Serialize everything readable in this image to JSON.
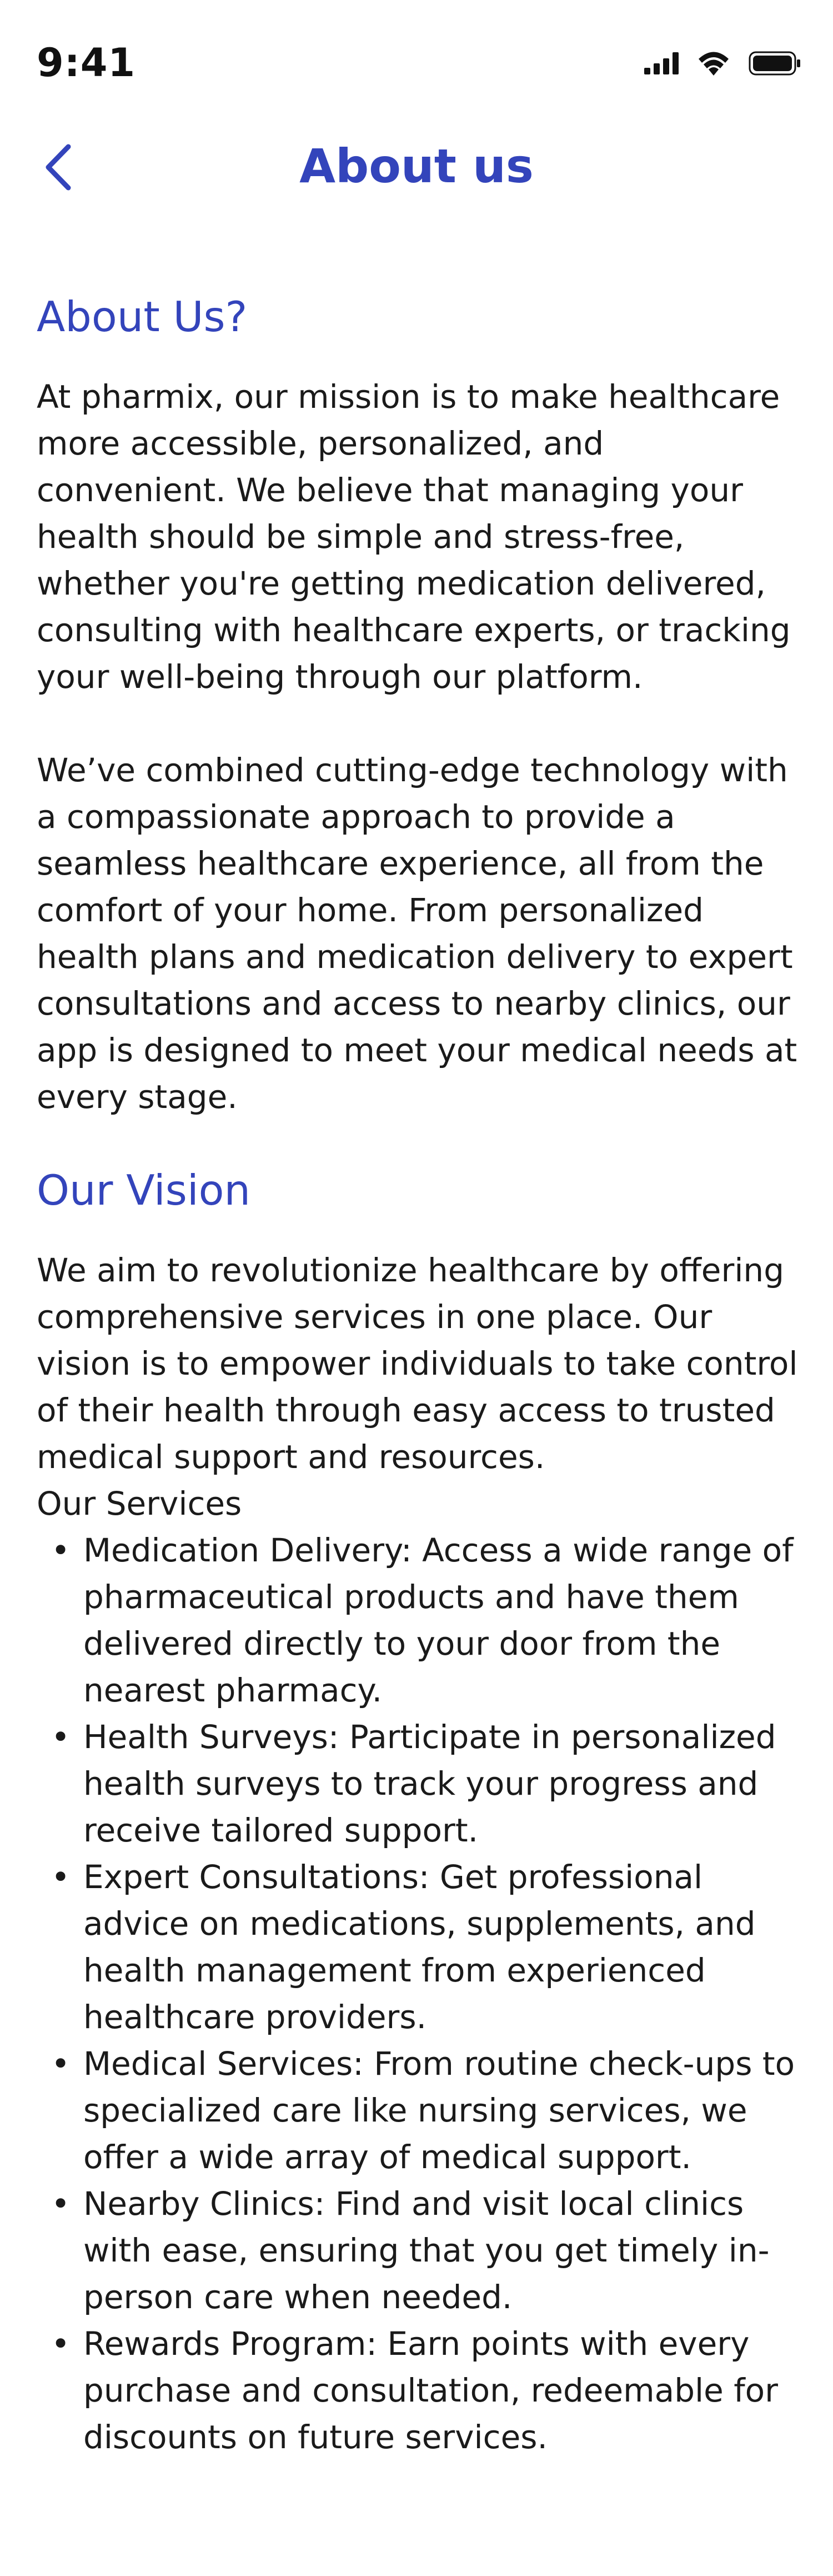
{
  "status_bar": {
    "time": "9:41",
    "icons": [
      "cellular-signal-icon",
      "wifi-icon",
      "battery-icon"
    ]
  },
  "nav": {
    "title": "About us",
    "back_icon": "chevron-left-icon"
  },
  "about": {
    "heading": "About Us?",
    "paragraphs": [
      "At pharmix, our mission is to make healthcare more accessible, personalized, and convenient. We believe that managing your health should be simple and stress-free, whether you're getting medication delivered, consulting with healthcare experts, or tracking your well-being through our platform.",
      "We’ve combined cutting-edge technology with a compassionate approach to provide a seamless healthcare experience, all from the comfort of your home. From personalized health plans and medication delivery to expert consultations and access to nearby clinics, our app is designed to meet your medical needs at every stage."
    ]
  },
  "vision": {
    "heading": "Our Vision",
    "paragraph": "We aim to revolutionize healthcare by offering comprehensive services in one place. Our vision is to empower individuals to take control of their health through easy access to trusted medical support and resources."
  },
  "services": {
    "label": "Our Services",
    "items": [
      "Medication Delivery: Access a wide range of pharmaceutical products and have them delivered directly to your door from the nearest pharmacy.",
      "Health Surveys: Participate in personalized health surveys to track your progress and receive tailored support.",
      "Expert Consultations: Get professional advice on medications, supplements, and health management from experienced healthcare providers.",
      "Medical Services: From routine check-ups to specialized care like nursing services, we offer a wide array of medical support.",
      "Nearby Clinics: Find and visit local clinics with ease, ensuring that you get timely in-person care when needed.",
      "Rewards Program: Earn points with every purchase and consultation, redeemable for discounts on future services."
    ]
  },
  "colors": {
    "accent": "#3344bb",
    "text": "#1a1a1a",
    "background": "#ffffff"
  }
}
